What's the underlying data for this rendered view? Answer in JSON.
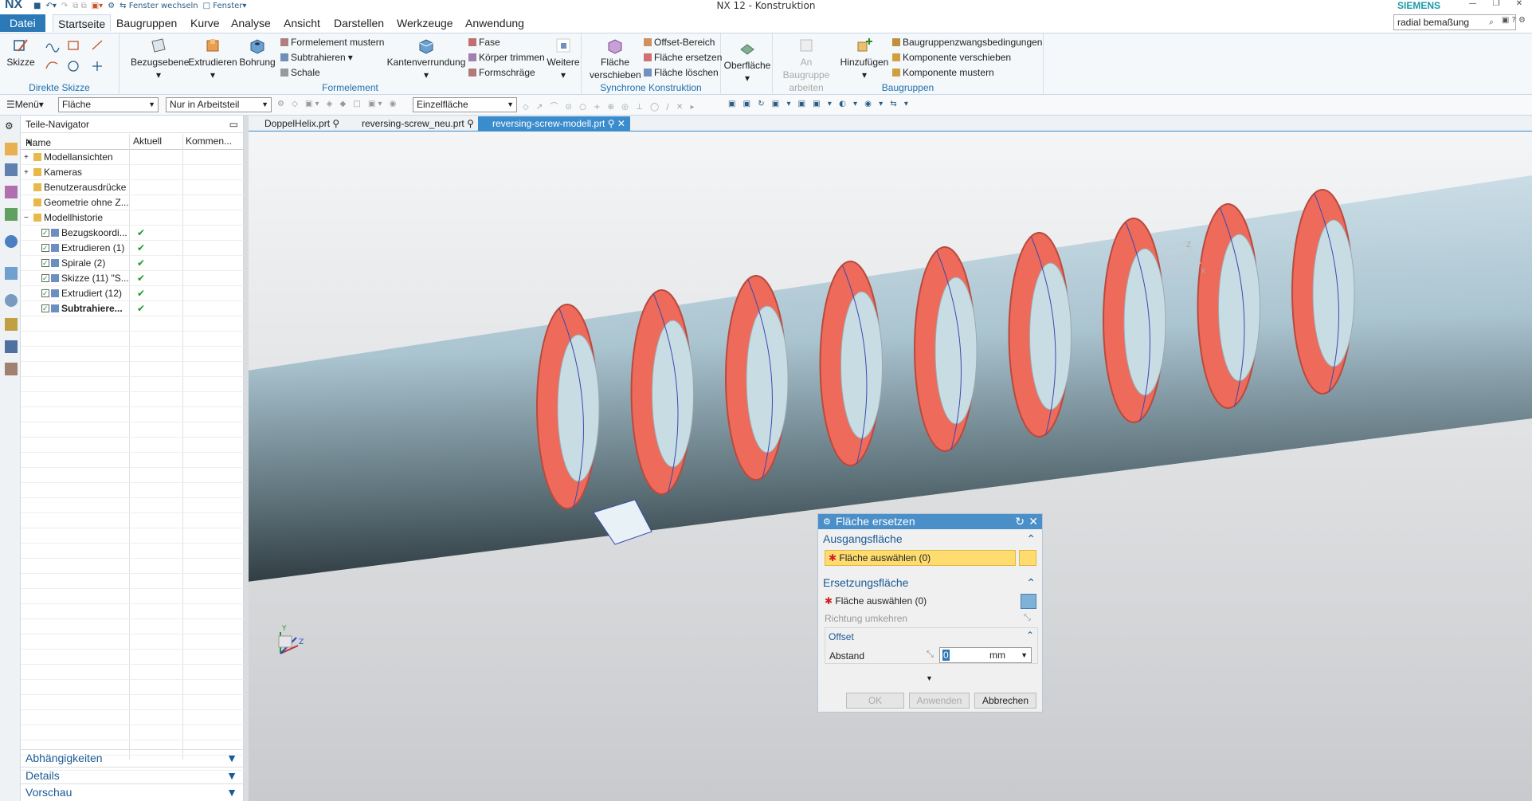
{
  "app": {
    "logo": "NX",
    "title": "NX 12 - Konstruktion",
    "brand": "SIEMENS",
    "switch_window": "Fenster wechseln",
    "window_menu": "Fenster"
  },
  "menu": {
    "tabs": [
      "Datei",
      "Startseite",
      "Baugruppen",
      "Kurve",
      "Analyse",
      "Ansicht",
      "Darstellen",
      "Werkzeuge",
      "Anwendung"
    ],
    "search_value": "radial bemaßung"
  },
  "ribbon": {
    "skizze": "Skizze",
    "direkte_skizze": "Direkte Skizze",
    "bezugsebene": "Bezugsebene",
    "extrudieren": "Extrudieren",
    "bohrung": "Bohrung",
    "formelement_mustern": "Formelement mustern",
    "subtrahieren": "Subtrahieren",
    "schale": "Schale",
    "kantenverrundung": "Kantenverrundung",
    "fase": "Fase",
    "koerper_trimmen": "Körper trimmen",
    "formschraege": "Formschräge",
    "weitere": "Weitere",
    "formelement": "Formelement",
    "flaeche_verschieben_1": "Fläche",
    "flaeche_verschieben_2": "verschieben",
    "offset_bereich": "Offset-Bereich",
    "flaeche_ersetzen": "Fläche ersetzen",
    "flaeche_loeschen": "Fläche löschen",
    "synchrone": "Synchrone Konstruktion",
    "oberflaeche": "Oberfläche",
    "an_baugruppe_1": "An Baugruppe",
    "an_baugruppe_2": "arbeiten",
    "hinzufuegen": "Hinzufügen",
    "baugruppenzwang": "Baugruppenzwangsbedingungen",
    "komponente_verschieben": "Komponente verschieben",
    "komponente_mustern": "Komponente mustern",
    "baugruppen": "Baugruppen"
  },
  "selbar": {
    "menu": "Menü",
    "filter": "Fläche",
    "scope": "Nur in Arbeitsteil",
    "rule": "Einzelfläche"
  },
  "navigator": {
    "title": "Teile-Navigator",
    "columns": [
      "Name",
      "Aktuell",
      "Kommen..."
    ],
    "items": [
      {
        "label": "Modellansichten",
        "indent": 0,
        "check": false
      },
      {
        "label": "Kameras",
        "indent": 0,
        "check": false
      },
      {
        "label": "Benutzerausdrücke",
        "indent": 0,
        "check": false
      },
      {
        "label": "Geometrie ohne Z...",
        "indent": 0,
        "check": false
      },
      {
        "label": "Modellhistorie",
        "indent": 0,
        "check": false
      },
      {
        "label": "Bezugskoordi...",
        "indent": 1,
        "check": true
      },
      {
        "label": "Extrudieren (1)",
        "indent": 1,
        "check": true
      },
      {
        "label": "Spirale (2)",
        "indent": 1,
        "check": true
      },
      {
        "label": "Skizze (11) \"S...",
        "indent": 1,
        "check": true
      },
      {
        "label": "Extrudiert (12)",
        "indent": 1,
        "check": true
      },
      {
        "label": "Subtrahiere...",
        "indent": 1,
        "check": true,
        "bold": true
      }
    ],
    "panels": [
      "Abhängigkeiten",
      "Details",
      "Vorschau"
    ]
  },
  "doc_tabs": [
    "DoppelHelix.prt",
    "reversing-screw_neu.prt",
    "reversing-screw-modell.prt"
  ],
  "dialog": {
    "title": "Fläche ersetzen",
    "section1": "Ausgangsfläche",
    "select1": "Fläche auswählen (0)",
    "section2": "Ersetzungsfläche",
    "select2": "Fläche auswählen (0)",
    "reverse": "Richtung umkehren",
    "offset": "Offset",
    "abstand": "Abstand",
    "value": "0",
    "unit": "mm",
    "ok": "OK",
    "apply": "Anwenden",
    "cancel": "Abbrechen"
  },
  "viewport": {
    "axis_z": "Z",
    "axis_x": "X",
    "axis_y": "Y"
  }
}
